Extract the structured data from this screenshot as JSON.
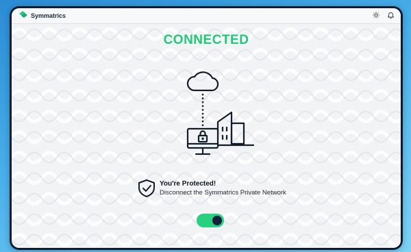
{
  "app": {
    "brand": "Symmatrics",
    "icons": {
      "logo": "symmatrics-logo-icon",
      "theme": "sun-icon",
      "notifications": "bell-icon"
    }
  },
  "main": {
    "status": "CONNECTED",
    "illustration": "cloud-building-computer-lock",
    "protection": {
      "title": "You're Protected!",
      "subtitle": "Disconnect the Symmatrics Private Network",
      "icon": "shield-check-icon"
    },
    "toggle": {
      "on": true
    }
  },
  "colors": {
    "accent": "#22c87a",
    "toggle_on": "#28d07f",
    "knob": "#14203a",
    "frame": "#0d1b2e",
    "background_start": "#2b8cd4",
    "background_end": "#7ed3f6"
  }
}
